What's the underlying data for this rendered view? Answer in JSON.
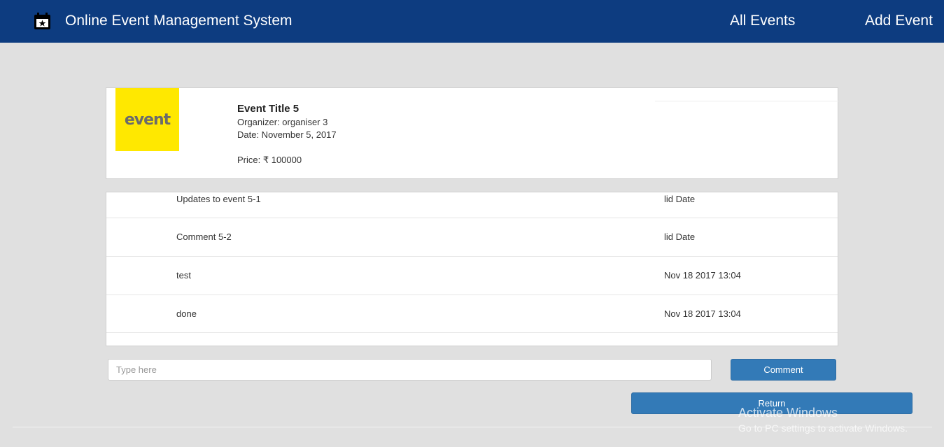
{
  "navbar": {
    "icon": "calendar-star-icon",
    "title": "Online Event Management System",
    "links": {
      "all_events": "All Events",
      "add_event": "Add Event"
    },
    "background": "#0d3c80"
  },
  "event": {
    "logo_text": "event",
    "logo_color": "#ffe800",
    "title": "Event Title 5",
    "organizer": "Organizer: organiser 3",
    "date": "Date: November 5, 2017",
    "price": "Price: ₹ 100000"
  },
  "comments": [
    {
      "text": "Updates to event 5-1",
      "date": "lid Date"
    },
    {
      "text": "Comment 5-2",
      "date": "lid Date"
    },
    {
      "text": "test",
      "date": "Nov 18 2017 13:04"
    },
    {
      "text": "done",
      "date": "Nov 18 2017 13:04"
    }
  ],
  "comment_form": {
    "placeholder": "Type here",
    "submit_label": "Comment"
  },
  "return_label": "Return",
  "watermark": {
    "title": "Activate Windows",
    "subtitle": "Go to PC settings to activate Windows."
  },
  "accent_color": "#337ab7"
}
